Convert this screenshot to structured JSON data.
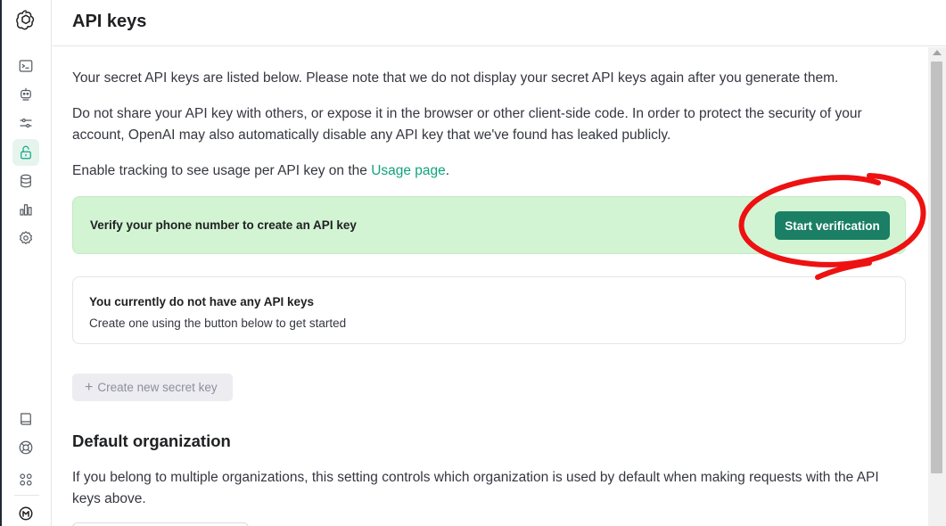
{
  "header": {
    "title": "API keys"
  },
  "sidebar": {
    "items": [
      {
        "name": "playground",
        "icon": "terminal-icon"
      },
      {
        "name": "assistants",
        "icon": "robot-icon"
      },
      {
        "name": "fine-tuning",
        "icon": "sliders-icon"
      },
      {
        "name": "api-keys",
        "icon": "lock-icon",
        "active": true
      },
      {
        "name": "storage",
        "icon": "database-icon"
      },
      {
        "name": "usage",
        "icon": "bar-chart-icon"
      },
      {
        "name": "settings",
        "icon": "gear-icon"
      }
    ],
    "bottom_items": [
      {
        "name": "documentation",
        "icon": "book-icon"
      },
      {
        "name": "help",
        "icon": "lifebuoy-icon"
      },
      {
        "name": "apps",
        "icon": "grid-icon"
      },
      {
        "name": "profile",
        "icon": "avatar-icon"
      }
    ]
  },
  "main": {
    "intro": "Your secret API keys are listed below. Please note that we do not display your secret API keys again after you generate them.",
    "warning_line1": "Do not share your API key with others, or expose it in the browser or other client-side code. In order to protect the security of your",
    "warning_line2": "account, OpenAI may also automatically disable any API key that we've found has leaked publicly.",
    "tracking_prefix": "Enable tracking to see usage per API key on the ",
    "tracking_link": "Usage page",
    "tracking_suffix": ".",
    "verify_banner": {
      "text": "Verify your phone number to create an API key",
      "button": "Start verification"
    },
    "empty_state": {
      "title": "You currently do not have any API keys",
      "subtitle": "Create one using the button below to get started"
    },
    "create_button": "Create new secret key",
    "default_org": {
      "title": "Default organization",
      "desc_line1": "If you belong to multiple organizations, this setting controls which organization is used by default when making requests with the API",
      "desc_line2": "keys above."
    }
  },
  "colors": {
    "accent": "#10a37f",
    "button": "#1a7f64",
    "banner_bg": "#d2f4d3",
    "annotation": "#ee1111"
  }
}
